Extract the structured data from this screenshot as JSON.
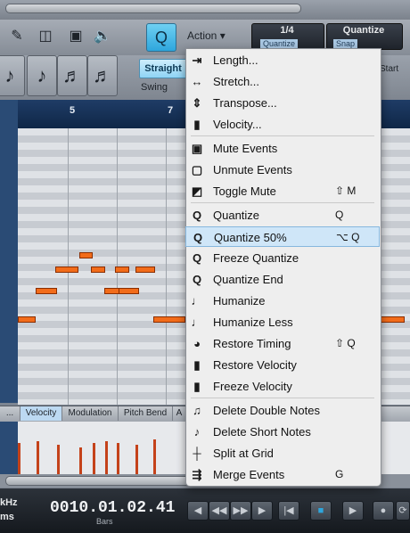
{
  "toolbar": {
    "action_label": "Action",
    "action_caret": "▾",
    "quantize_button_label": "Q",
    "grid_value": "1/4",
    "grid_sub_label": "Quantize",
    "quantize_value": "Quantize",
    "quantize_sub_label": "Snap"
  },
  "note_values": [
    "♪",
    "♪",
    "♬",
    "♬"
  ],
  "quantize_mode": {
    "straight_label": "Straight",
    "swing_label": "Swing",
    "start_label": "Start"
  },
  "ruler": {
    "bars": [
      "5",
      "7"
    ]
  },
  "lanes": {
    "tabs": [
      "...",
      "Velocity",
      "Modulation",
      "Pitch Bend",
      "A"
    ],
    "active": "Velocity"
  },
  "transport": {
    "sample_rate_fragment": "kHz",
    "latency_fragment": "ms",
    "position": "0010.01.02.41",
    "position_unit": "Bars",
    "buttons": [
      "◀",
      "◀◀",
      "▶▶",
      "▶",
      "|◀",
      "■",
      "▶",
      "●",
      "⟳"
    ]
  },
  "menu": {
    "items": [
      {
        "icon": "length-icon",
        "glyph": "⇥",
        "label": "Length...",
        "shortcut": ""
      },
      {
        "icon": "stretch-icon",
        "glyph": "↔",
        "label": "Stretch...",
        "shortcut": ""
      },
      {
        "icon": "transpose-icon",
        "glyph": "⇕",
        "label": "Transpose...",
        "shortcut": ""
      },
      {
        "icon": "velocity-icon",
        "glyph": "▮",
        "label": "Velocity...",
        "shortcut": ""
      },
      {
        "icon": "mute-icon",
        "glyph": "▣",
        "label": "Mute Events",
        "shortcut": ""
      },
      {
        "icon": "unmute-icon",
        "glyph": "▢",
        "label": "Unmute Events",
        "shortcut": ""
      },
      {
        "icon": "toggle-mute-icon",
        "glyph": "◩",
        "label": "Toggle Mute",
        "shortcut": "⇧ M"
      },
      {
        "icon": "quantize-icon",
        "glyph": "Q",
        "label": "Quantize",
        "shortcut": "Q"
      },
      {
        "icon": "quantize-50-icon",
        "glyph": "Q",
        "label": "Quantize 50%",
        "shortcut": "⌥ Q"
      },
      {
        "icon": "freeze-quantize-icon",
        "glyph": "Q",
        "label": "Freeze Quantize",
        "shortcut": ""
      },
      {
        "icon": "quantize-end-icon",
        "glyph": "Q",
        "label": "Quantize End",
        "shortcut": ""
      },
      {
        "icon": "humanize-icon",
        "glyph": "♩",
        "label": "Humanize",
        "shortcut": ""
      },
      {
        "icon": "humanize-less-icon",
        "glyph": "♩",
        "label": "Humanize Less",
        "shortcut": ""
      },
      {
        "icon": "restore-timing-icon",
        "glyph": "◕",
        "label": "Restore Timing",
        "shortcut": "⇧ Q"
      },
      {
        "icon": "restore-velocity-icon",
        "glyph": "▮",
        "label": "Restore Velocity",
        "shortcut": ""
      },
      {
        "icon": "freeze-velocity-icon",
        "glyph": "▮",
        "label": "Freeze Velocity",
        "shortcut": ""
      },
      {
        "icon": "delete-double-notes-icon",
        "glyph": "♫",
        "label": "Delete Double Notes",
        "shortcut": ""
      },
      {
        "icon": "delete-short-notes-icon",
        "glyph": "♪",
        "label": "Delete Short Notes",
        "shortcut": ""
      },
      {
        "icon": "split-at-grid-icon",
        "glyph": "┼",
        "label": "Split at Grid",
        "shortcut": ""
      },
      {
        "icon": "merge-events-icon",
        "glyph": "⇶",
        "label": "Merge Events",
        "shortcut": "G"
      }
    ],
    "highlighted": "Quantize 50%"
  },
  "colors": {
    "accent": "#2ea6dd",
    "note": "#f26c1a",
    "highlight": "#cfe6f8"
  }
}
